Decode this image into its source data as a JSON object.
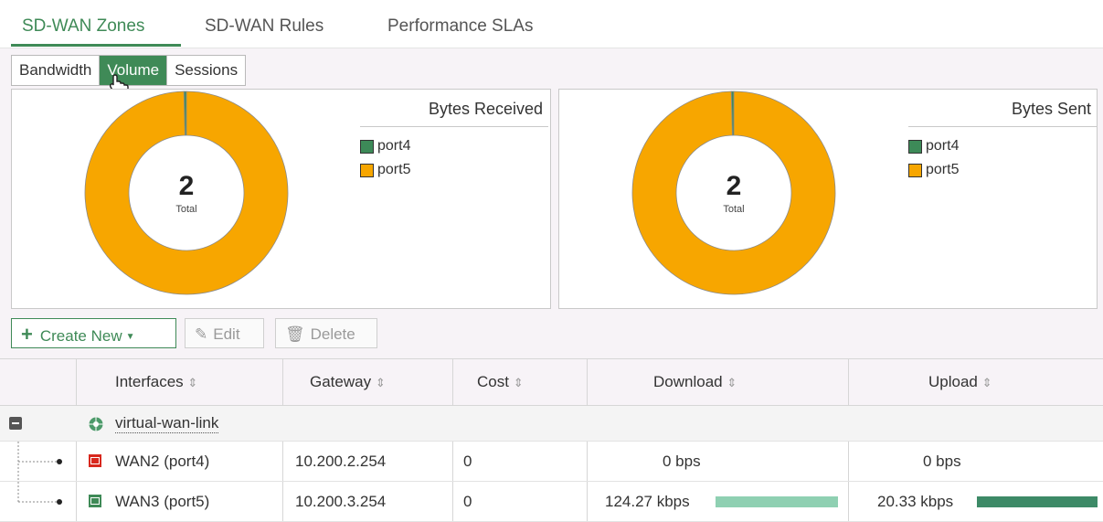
{
  "tabs": [
    "SD-WAN Zones",
    "SD-WAN Rules",
    "Performance SLAs"
  ],
  "view_toggle": [
    "Bandwidth",
    "Volume",
    "Sessions"
  ],
  "charts": {
    "received": {
      "title": "Bytes Received",
      "total": "2",
      "total_label": "Total"
    },
    "sent": {
      "title": "Bytes Sent",
      "total": "2",
      "total_label": "Total"
    }
  },
  "colors": {
    "accent": "#3f8a57",
    "port4": "#3d8a58",
    "port5": "#f7a600",
    "download_bar": "#8fd0b2",
    "upload_bar": "#3d8a67"
  },
  "chart_data": [
    {
      "type": "pie",
      "title": "Bytes Received",
      "categories": [
        "port4",
        "port5"
      ],
      "values": [
        0.4,
        99.6
      ],
      "center_value": "2",
      "center_label": "Total"
    },
    {
      "type": "pie",
      "title": "Bytes Sent",
      "categories": [
        "port4",
        "port5"
      ],
      "values": [
        0.4,
        99.6
      ],
      "center_value": "2",
      "center_label": "Total"
    }
  ],
  "toolbar": {
    "create_new": "Create New",
    "edit": "Edit",
    "delete": "Delete"
  },
  "table": {
    "headers": [
      "Interfaces",
      "Gateway",
      "Cost",
      "Download",
      "Upload"
    ],
    "group": {
      "name": "virtual-wan-link"
    },
    "rows": [
      {
        "interface": "WAN2 (port4)",
        "gateway": "10.200.2.254",
        "cost": "0",
        "download": "0 bps",
        "upload": "0 bps",
        "download_fraction": 0,
        "upload_fraction": 0
      },
      {
        "interface": "WAN3 (port5)",
        "gateway": "10.200.3.254",
        "cost": "0",
        "download": "124.27 kbps",
        "upload": "20.33 kbps",
        "download_fraction": 1,
        "upload_fraction": 1
      }
    ]
  }
}
